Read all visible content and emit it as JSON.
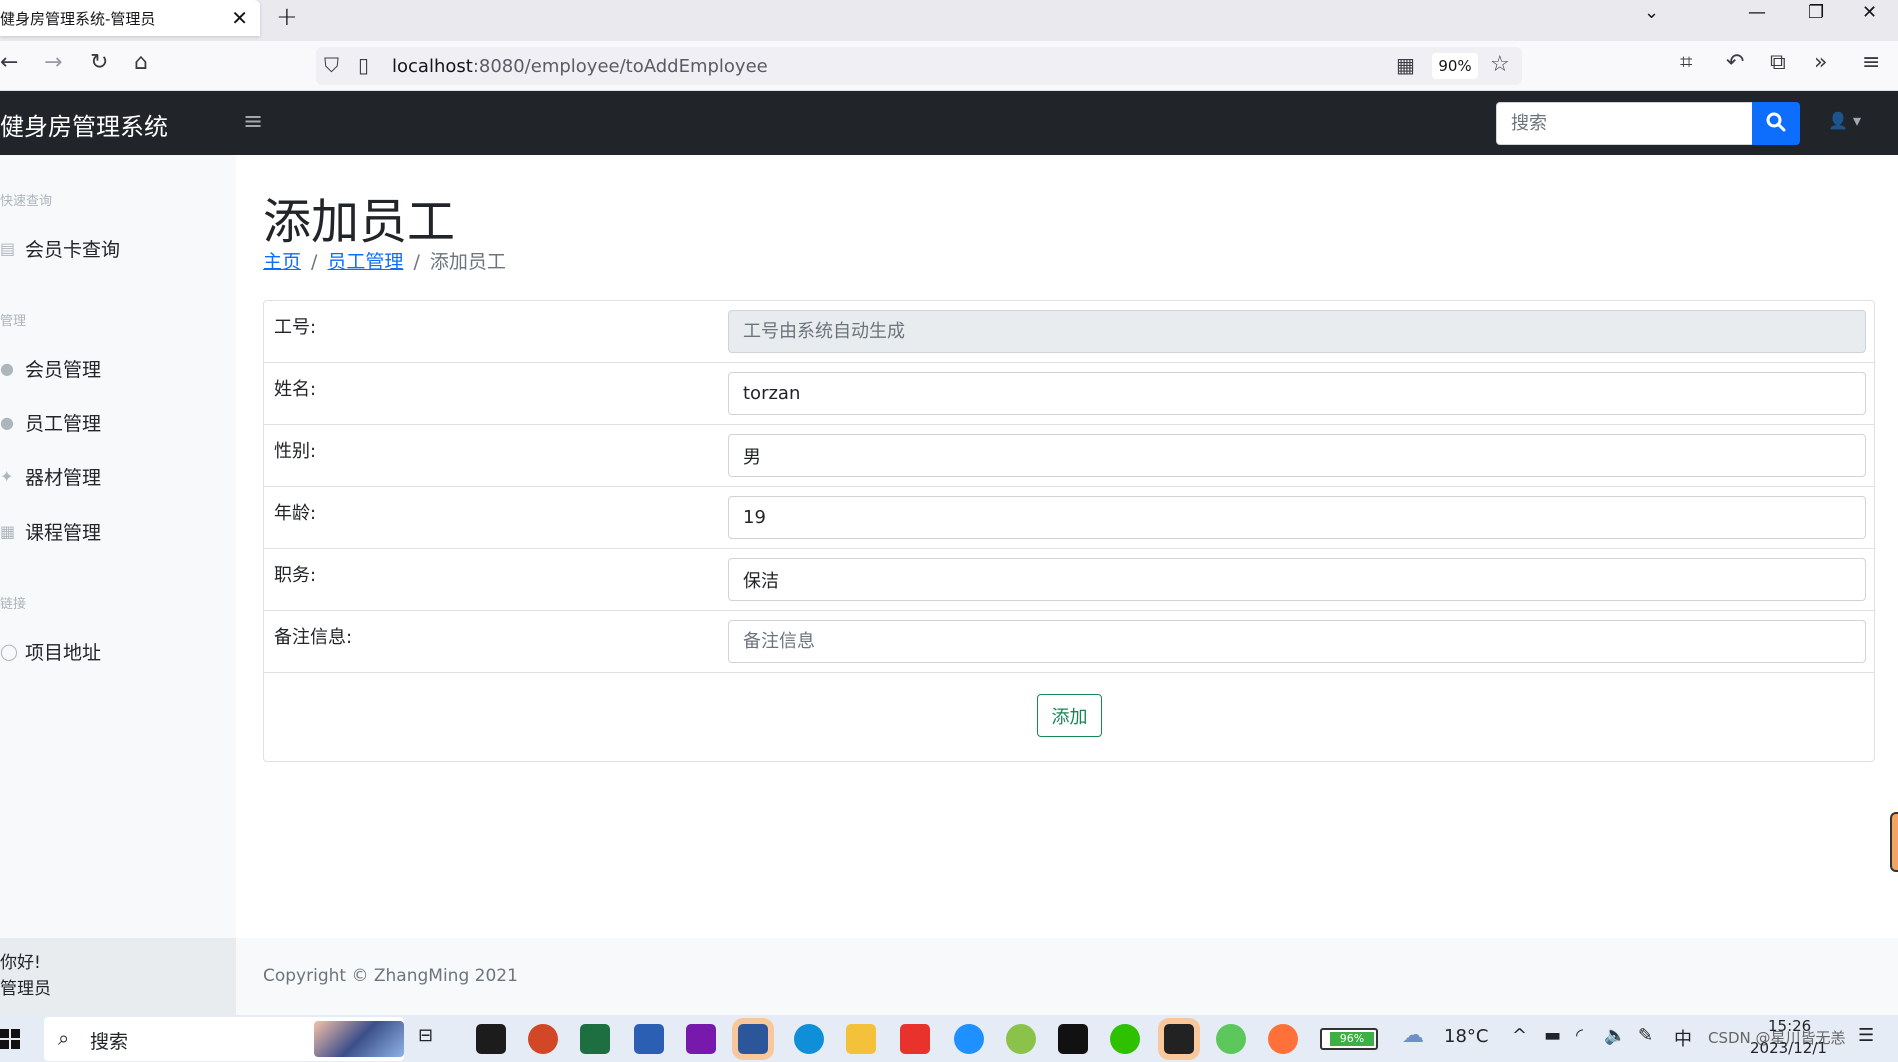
{
  "browser": {
    "tab_title": "健身房管理系统-管理员",
    "url_host": "localhost",
    "url_path": ":8080/employee/toAddEmployee",
    "zoom": "90%"
  },
  "app": {
    "brand": "健身房管理系统",
    "search_placeholder": "搜索"
  },
  "sidebar": {
    "sections": [
      {
        "heading": "快速查询",
        "items": [
          {
            "label": "会员卡查询",
            "icon": "card-icon"
          }
        ]
      },
      {
        "heading": "管理",
        "items": [
          {
            "label": "会员管理",
            "icon": "user-icon"
          },
          {
            "label": "员工管理",
            "icon": "user-tie-icon"
          },
          {
            "label": "器材管理",
            "icon": "equipment-icon"
          },
          {
            "label": "课程管理",
            "icon": "calendar-icon"
          }
        ]
      },
      {
        "heading": "链接",
        "items": [
          {
            "label": "项目地址",
            "icon": "github-icon"
          }
        ]
      }
    ],
    "footer_greeting": "你好!",
    "footer_role": "管理员"
  },
  "main": {
    "title": "添加员工",
    "breadcrumb": {
      "home": "主页",
      "parent": "员工管理",
      "current": "添加员工"
    },
    "form": {
      "id_label": "工号:",
      "id_placeholder": "工号由系统自动生成",
      "name_label": "姓名:",
      "name_value": "torzan",
      "gender_label": "性别:",
      "gender_value": "男",
      "age_label": "年龄:",
      "age_value": "19",
      "position_label": "职务:",
      "position_value": "保洁",
      "remark_label": "备注信息:",
      "remark_placeholder": "备注信息",
      "submit_label": "添加"
    },
    "copyright": "Copyright © ZhangMing 2021"
  },
  "taskbar": {
    "search_label": "搜索",
    "temperature": "18°C",
    "battery": "96%",
    "ime": "中",
    "time": "15:26",
    "date": "2023/12/1",
    "watermark": "CSDN @星川皆无恙"
  },
  "colors": {
    "navbar_bg": "#212529",
    "primary": "#0d6efd",
    "success": "#198754",
    "sidebar_bg": "#f8f9fa"
  }
}
